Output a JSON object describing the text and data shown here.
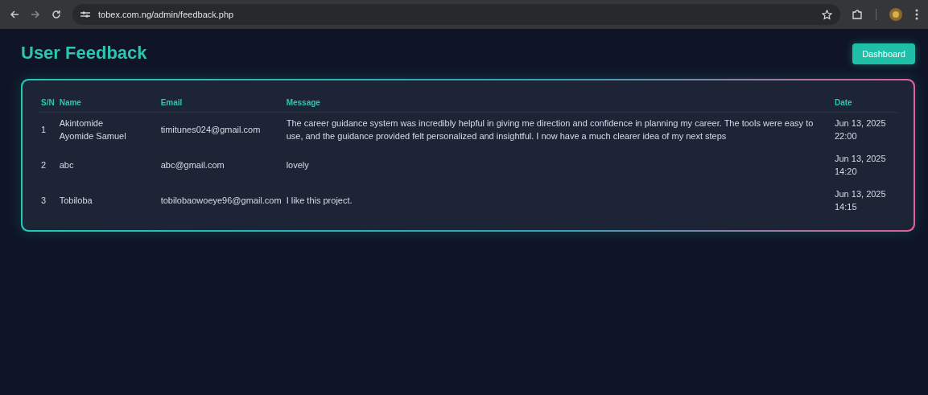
{
  "browser": {
    "url": "tobex.com.ng/admin/feedback.php"
  },
  "page": {
    "title": "User Feedback",
    "dashboard_button": "Dashboard"
  },
  "table": {
    "columns": [
      "S/N",
      "Name",
      "Email",
      "Message",
      "Date"
    ],
    "rows": [
      {
        "sn": "1",
        "name": "Akintomide Ayomide Samuel",
        "email": "timitunes024@gmail.com",
        "message": "The career guidance system was incredibly helpful in giving me direction and confidence in planning my career. The tools were easy to use, and the guidance provided felt personalized and insightful. I now have a much clearer idea of my next steps",
        "date": "Jun 13, 2025 22:00"
      },
      {
        "sn": "2",
        "name": "abc",
        "email": "abc@gmail.com",
        "message": "lovely",
        "date": "Jun 13, 2025 14:20"
      },
      {
        "sn": "3",
        "name": "Tobiloba",
        "email": "tobilobaowoeye96@gmail.com",
        "message": "I like this project.",
        "date": "Jun 13, 2025 14:15"
      }
    ]
  }
}
